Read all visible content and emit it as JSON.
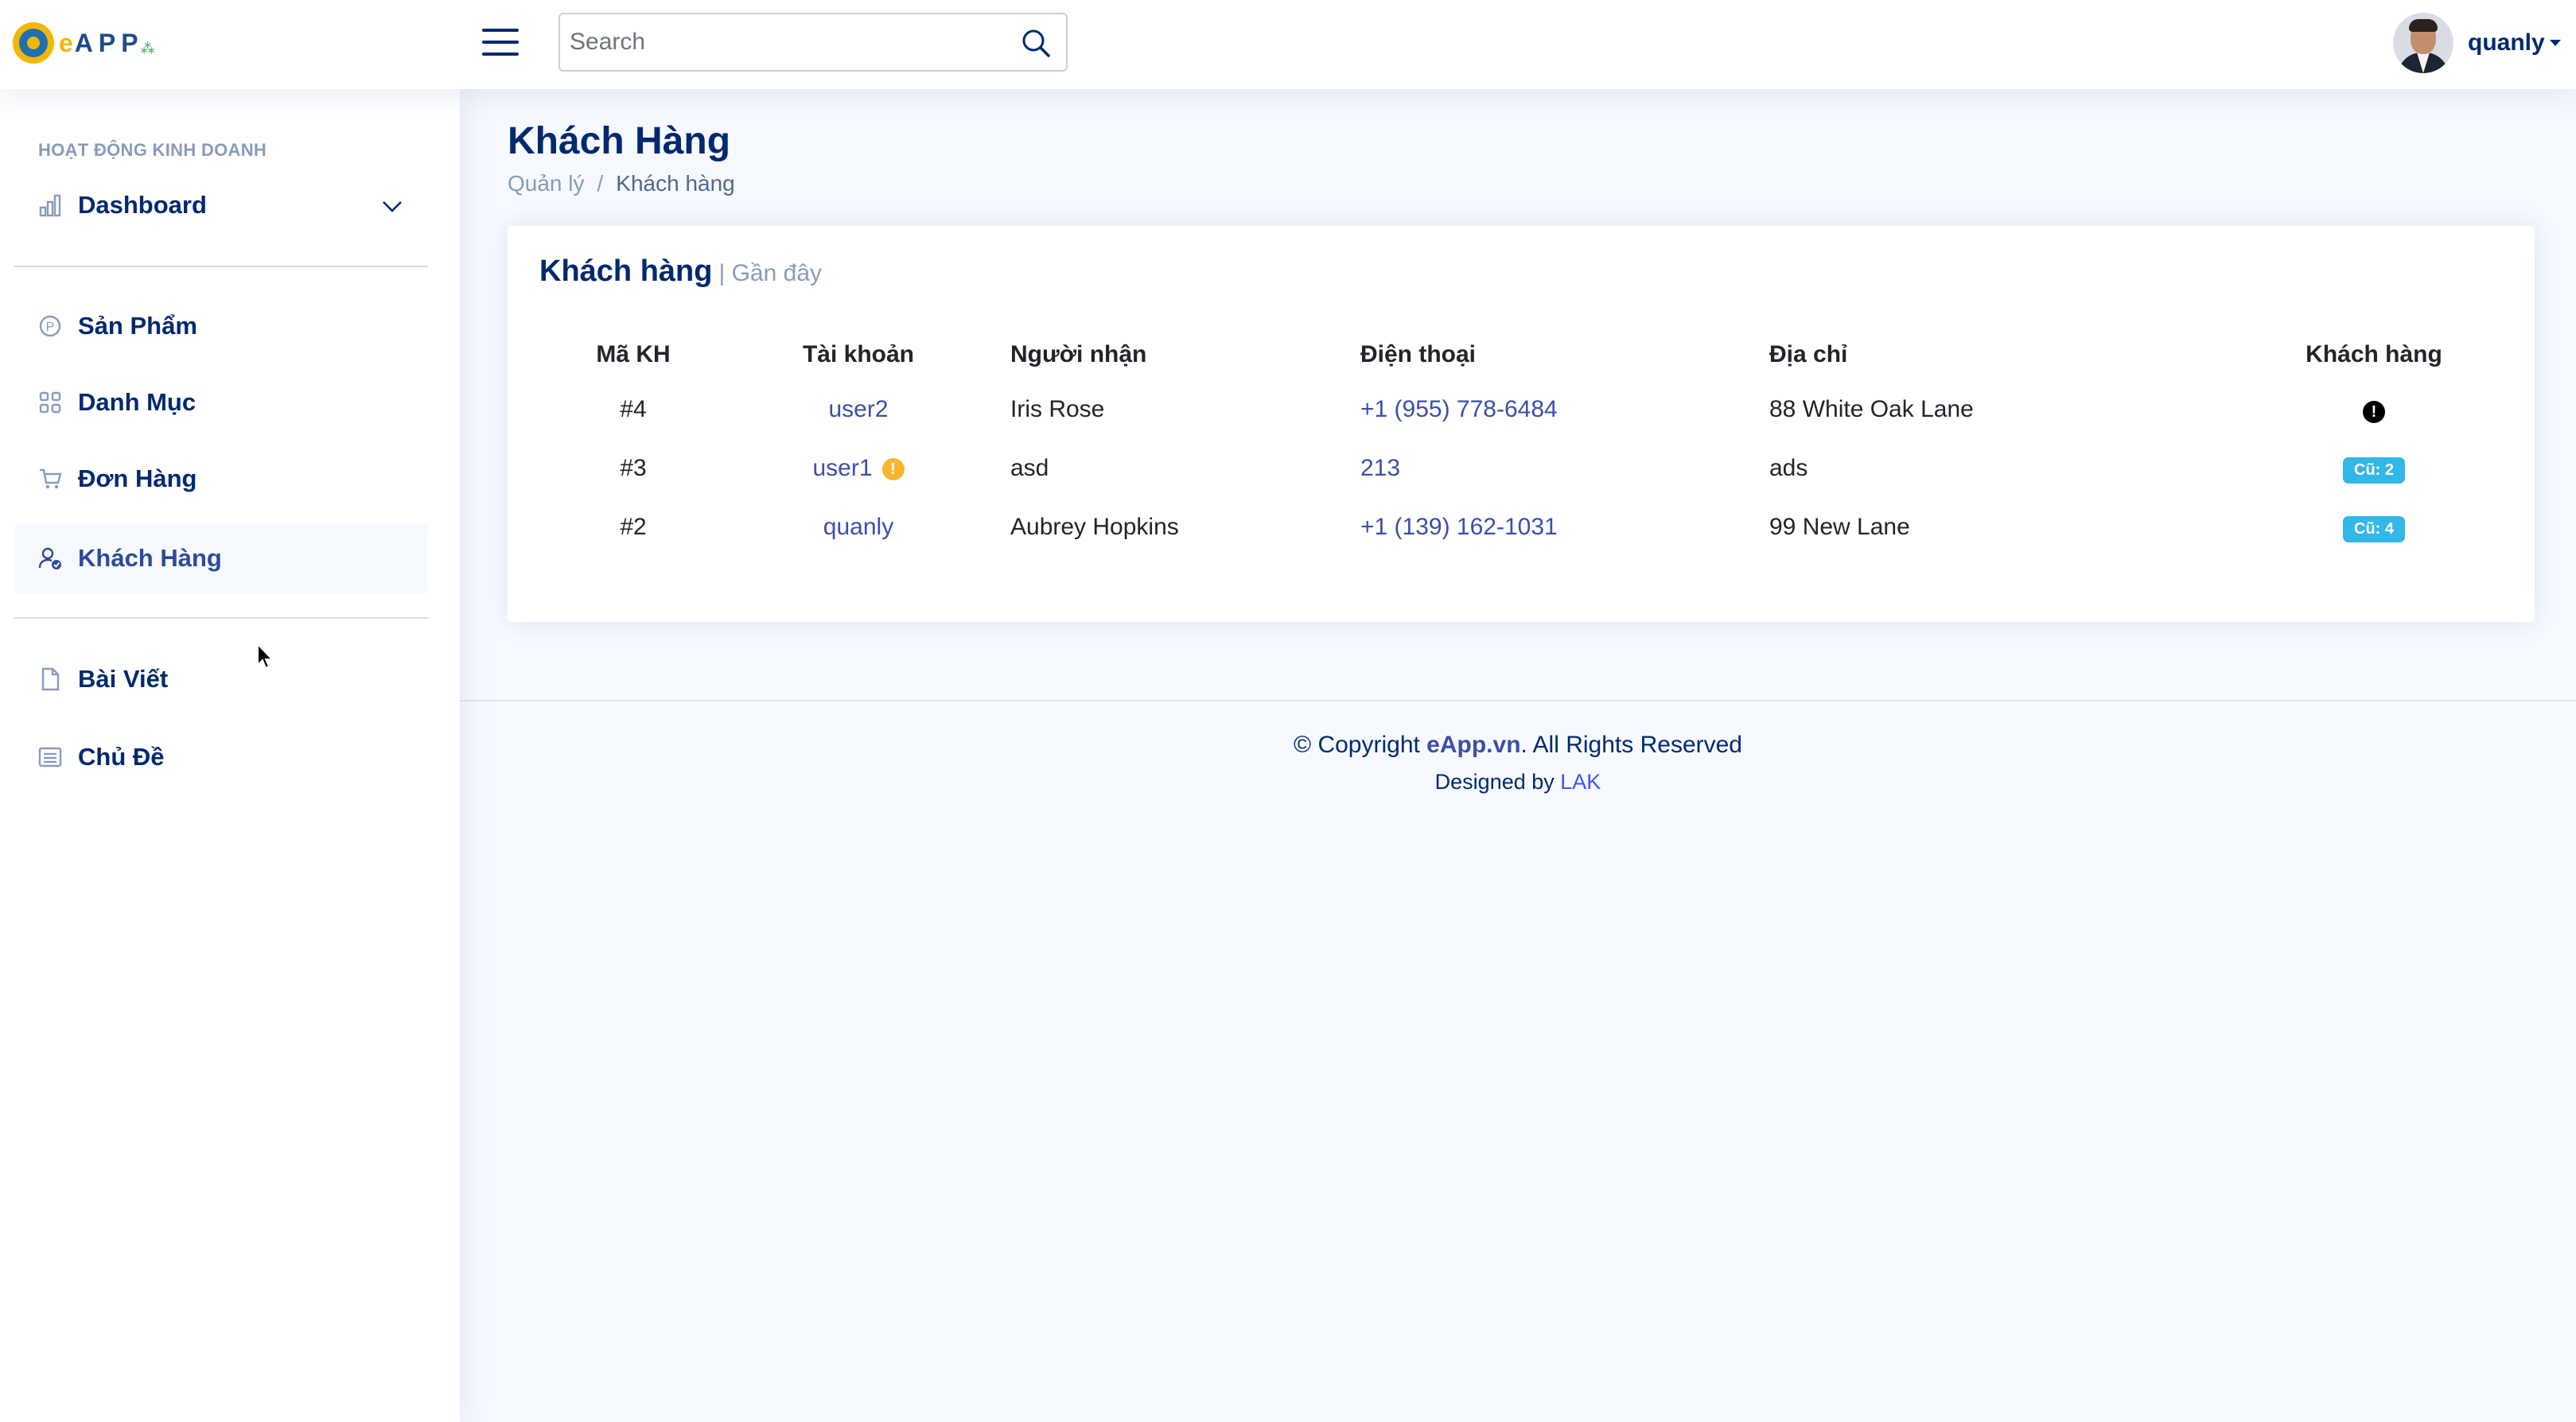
{
  "brand": {
    "logo_text": "eAPP"
  },
  "header": {
    "search_placeholder": "Search",
    "user_name": "quanly"
  },
  "sidebar": {
    "heading": "HOẠT ĐỘNG KINH DOANH",
    "dashboard": "Dashboard",
    "items": [
      {
        "label": "Sản Phẩm",
        "icon": "product-icon"
      },
      {
        "label": "Danh Mục",
        "icon": "grid-icon"
      },
      {
        "label": "Đơn Hàng",
        "icon": "cart-icon"
      },
      {
        "label": "Khách Hàng",
        "icon": "person-check-icon",
        "active": true
      }
    ],
    "items2": [
      {
        "label": "Bài Viết",
        "icon": "file-icon"
      },
      {
        "label": "Chủ Đề",
        "icon": "list-icon"
      }
    ]
  },
  "page": {
    "title": "Khách Hàng",
    "breadcrumb": [
      "Quản lý",
      "Khách hàng"
    ]
  },
  "card": {
    "title": "Khách hàng",
    "subtitle": "| Gần đây",
    "columns": [
      "Mã KH",
      "Tài khoản",
      "Người nhận",
      "Điện thoại",
      "Địa chỉ",
      "Khách hàng"
    ],
    "rows": [
      {
        "id": "#4",
        "account": "user2",
        "warn": false,
        "name": "Iris Rose",
        "phone": "+1 (955) 778-6484",
        "address": "88 White Oak Lane",
        "customer": "!",
        "customer_type": "icon"
      },
      {
        "id": "#3",
        "account": "user1",
        "warn": true,
        "name": "asd",
        "phone": "213",
        "address": "ads",
        "customer": "Cũ: 2",
        "customer_type": "badge"
      },
      {
        "id": "#2",
        "account": "quanly",
        "warn": false,
        "name": "Aubrey Hopkins",
        "phone": "+1 (139) 162-1031",
        "address": "99 New Lane",
        "customer": "Cũ: 4",
        "customer_type": "badge"
      }
    ]
  },
  "footer": {
    "copyright_prefix": "© Copyright ",
    "copyright_brand": "eApp.vn",
    "copyright_suffix": ". All Rights Reserved",
    "designed_by": "Designed by ",
    "designer": "LAK"
  }
}
